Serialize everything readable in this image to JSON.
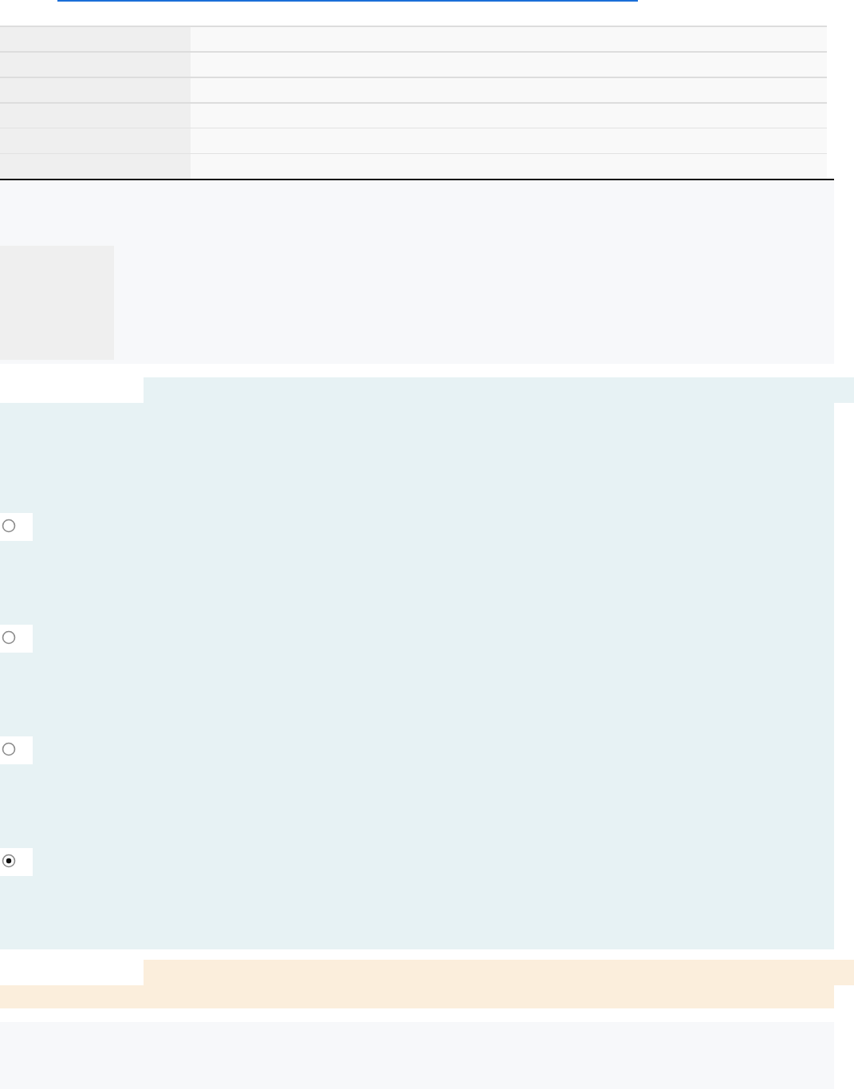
{
  "question": {
    "options": [
      {
        "selected": false
      },
      {
        "selected": false
      },
      {
        "selected": false
      },
      {
        "selected": true
      }
    ]
  }
}
